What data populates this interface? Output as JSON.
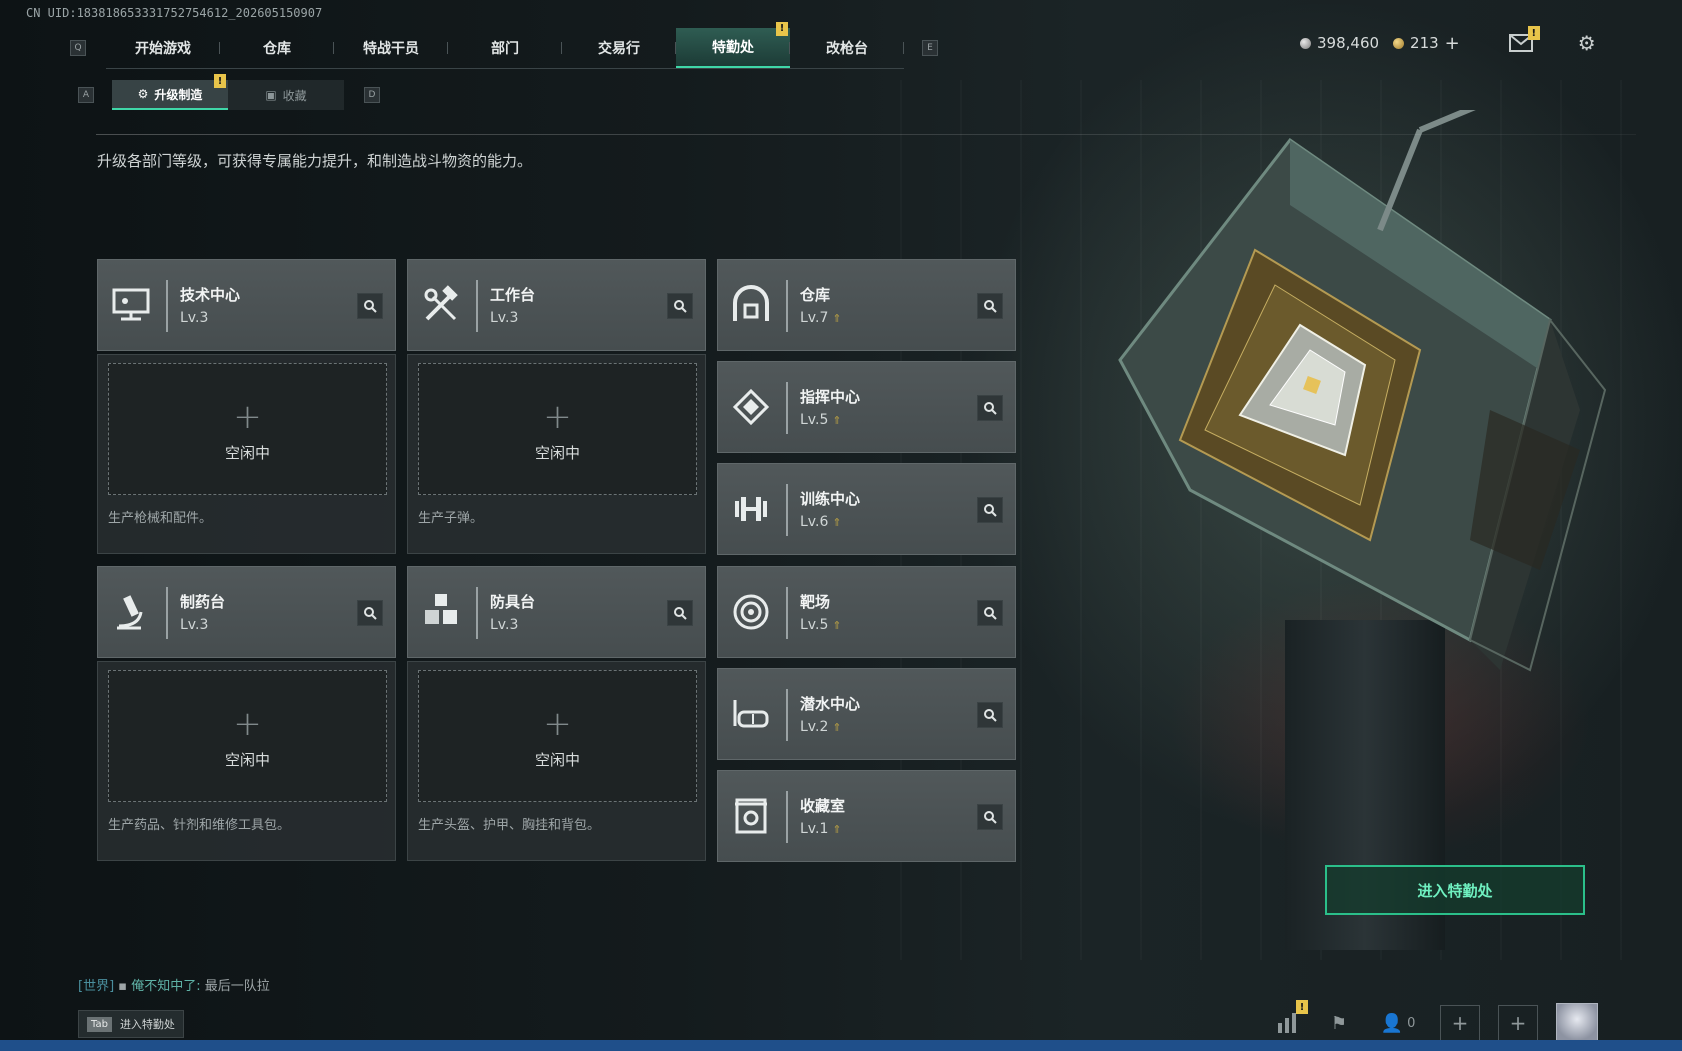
{
  "uid_text": "CN UID:18381865333175275461​2_202605150907",
  "nav": {
    "key_left": "Q",
    "key_right": "E",
    "tabs": [
      "开始游戏",
      "仓库",
      "特战干员",
      "部门",
      "交易行",
      "特勤处",
      "改枪台"
    ],
    "active_tab": "特勤处",
    "badge": "!"
  },
  "subnav": {
    "key_left": "A",
    "key_right": "D",
    "tabs": [
      "升级制造",
      "收藏"
    ],
    "active": "升级制造",
    "badge": "!"
  },
  "currency": {
    "silver": "398,460",
    "gold": "213",
    "add": "+"
  },
  "description": "升级各部门等级，可获得专属能力提升，和制造战斗物资的能力。",
  "production": [
    {
      "name": "技术中心",
      "level": "Lv.3",
      "icon": "computer-icon",
      "slot_label": "空闲中",
      "plus": "+",
      "desc": "生产枪械和配件。"
    },
    {
      "name": "工作台",
      "level": "Lv.3",
      "icon": "hammer-wrench-icon",
      "slot_label": "空闲中",
      "plus": "+",
      "desc": "生产子弹。"
    },
    {
      "name": "制药台",
      "level": "Lv.3",
      "icon": "microscope-icon",
      "slot_label": "空闲中",
      "plus": "+",
      "desc": "生产药品、针剂和维修工具包。"
    },
    {
      "name": "防具台",
      "level": "Lv.3",
      "icon": "boxes-icon",
      "slot_label": "空闲中",
      "plus": "+",
      "desc": "生产头盔、护甲、胸挂和背包。"
    }
  ],
  "facilities": [
    {
      "name": "仓库",
      "level": "Lv.7",
      "icon": "warehouse-icon",
      "upgradable": true
    },
    {
      "name": "指挥中心",
      "level": "Lv.5",
      "icon": "command-icon",
      "upgradable": true
    },
    {
      "name": "训练中心",
      "level": "Lv.6",
      "icon": "dumbbell-icon",
      "upgradable": true
    },
    {
      "name": "靶场",
      "level": "Lv.5",
      "icon": "target-icon",
      "upgradable": true
    },
    {
      "name": "潜水中心",
      "level": "Lv.2",
      "icon": "diving-mask-icon",
      "upgradable": true
    },
    {
      "name": "收藏室",
      "level": "Lv.1",
      "icon": "vault-icon",
      "upgradable": true
    }
  ],
  "enter_button": "进入特勤处",
  "chat": {
    "channel": "[世界]",
    "user": "俺不知中了:",
    "message": "最后一队拉"
  },
  "tab_hint": {
    "key": "Tab",
    "label": "进入特勤处"
  },
  "bottom": {
    "friends_count": "0"
  },
  "colors": {
    "accent": "#3fd7a8",
    "badge": "#e8c44a",
    "upgrade": "#b59d45"
  }
}
